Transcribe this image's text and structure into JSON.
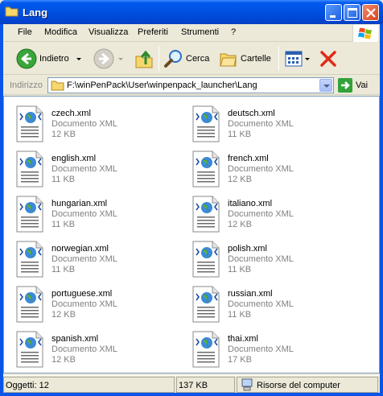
{
  "window": {
    "title": "Lang"
  },
  "menu": [
    "File",
    "Modifica",
    "Visualizza",
    "Preferiti",
    "Strumenti",
    "?"
  ],
  "toolbar": {
    "back_label": "Indietro",
    "search_label": "Cerca",
    "folders_label": "Cartelle"
  },
  "address": {
    "label": "Indirizzo",
    "path": "F:\\winPenPack\\User\\winpenpack_launcher\\Lang",
    "go_label": "Vai"
  },
  "files": [
    {
      "name": "czech.xml",
      "type": "Documento XML",
      "size": "12 KB"
    },
    {
      "name": "deutsch.xml",
      "type": "Documento XML",
      "size": "11 KB"
    },
    {
      "name": "english.xml",
      "type": "Documento XML",
      "size": "11 KB"
    },
    {
      "name": "french.xml",
      "type": "Documento XML",
      "size": "12 KB"
    },
    {
      "name": "hungarian.xml",
      "type": "Documento XML",
      "size": "11 KB"
    },
    {
      "name": "italiano.xml",
      "type": "Documento XML",
      "size": "12 KB"
    },
    {
      "name": "norwegian.xml",
      "type": "Documento XML",
      "size": "11 KB"
    },
    {
      "name": "polish.xml",
      "type": "Documento XML",
      "size": "11 KB"
    },
    {
      "name": "portuguese.xml",
      "type": "Documento XML",
      "size": "12 KB"
    },
    {
      "name": "russian.xml",
      "type": "Documento XML",
      "size": "11 KB"
    },
    {
      "name": "spanish.xml",
      "type": "Documento XML",
      "size": "12 KB"
    },
    {
      "name": "thai.xml",
      "type": "Documento XML",
      "size": "17 KB"
    }
  ],
  "status": {
    "objects": "Oggetti: 12",
    "size": "137 KB",
    "zone": "Risorse del computer"
  },
  "colors": {
    "titlebar": "#0054e3",
    "close": "#d7431c",
    "accent_green": "#33a23a"
  }
}
